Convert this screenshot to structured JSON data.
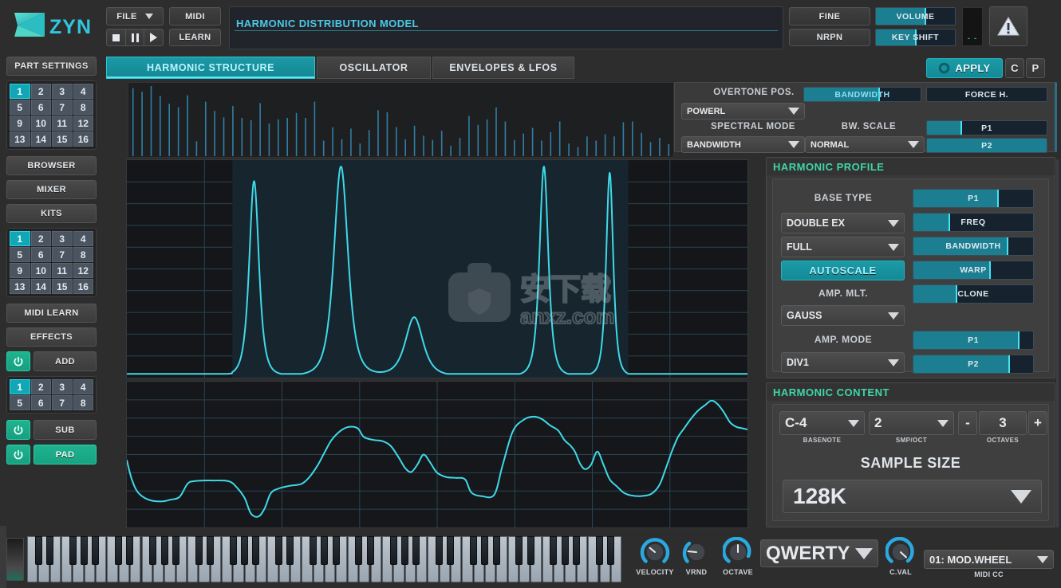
{
  "app": {
    "name": "ZYN",
    "accent_teal": "#13a6b5",
    "accent_green": "#3fd6a8",
    "curve_color": "#3fd9e8"
  },
  "header": {
    "file_menu": "FILE",
    "midi_button": "MIDI",
    "learn_button": "LEARN",
    "transport": {
      "stop": "stop-icon",
      "pause": "pause-icon",
      "play": "play-icon"
    },
    "title": "HARMONIC DISTRIBUTION MODEL",
    "fine_button": "FINE",
    "nrpn_button": "NRPN",
    "volume_slider": "VOLUME",
    "keyshift_slider": "KEY SHIFT",
    "meter_label": "- -",
    "warning_icon": "warning-triangle-icon"
  },
  "apply_row": {
    "apply": "APPLY",
    "copy": "C",
    "paste": "P"
  },
  "tabs": [
    {
      "label": "HARMONIC STRUCTURE",
      "active": true
    },
    {
      "label": "OSCILLATOR",
      "active": false
    },
    {
      "label": "ENVELOPES & LFOS",
      "active": false
    }
  ],
  "sidebar": {
    "part_settings": "PART SETTINGS",
    "part_numbers": [
      "1",
      "2",
      "3",
      "4",
      "5",
      "6",
      "7",
      "8",
      "9",
      "10",
      "11",
      "12",
      "13",
      "14",
      "15",
      "16"
    ],
    "part_selected": "1",
    "browser": "BROWSER",
    "mixer": "MIXER",
    "kits": "KITS",
    "kit_numbers": [
      "1",
      "2",
      "3",
      "4",
      "5",
      "6",
      "7",
      "8",
      "9",
      "10",
      "11",
      "12",
      "13",
      "14",
      "15",
      "16"
    ],
    "kit_selected": "1",
    "midi_learn": "MIDI LEARN",
    "effects": "EFFECTS",
    "add_label": "ADD",
    "add_voice_numbers": [
      "1",
      "2",
      "3",
      "4",
      "5",
      "6",
      "7",
      "8"
    ],
    "add_voice_selected": "1",
    "sub_label": "SUB",
    "pad_label": "PAD",
    "power_icon": "power-icon"
  },
  "top_settings": {
    "overtone_pos_label": "OVERTONE POS.",
    "overtone_pos_value": "POWERL",
    "bandwidth_slider": "BANDWIDTH",
    "bandwidth_slider_pct": 64,
    "force_h_slider": "FORCE H.",
    "force_h_pct": 0,
    "spectral_mode_label": "SPECTRAL MODE",
    "spectral_mode_value": "BANDWIDTH",
    "bw_scale_label": "BW. SCALE",
    "bw_scale_value": "NORMAL",
    "p1_slider": "P1",
    "p1_pct": 28,
    "p2_slider": "P2",
    "p2_pct": 100
  },
  "harmonic_profile": {
    "title": "HARMONIC PROFILE",
    "base_type_label": "BASE TYPE",
    "base_type_value": "DOUBLE EX",
    "shape_value": "FULL",
    "autoscale": "AUTOSCALE",
    "amp_mlt_label": "AMP. MLT.",
    "amp_mlt_value": "GAUSS",
    "amp_mode_label": "AMP. MODE",
    "amp_mode_value": "DIV1",
    "p1_slider": "P1",
    "p1_pct": 70,
    "freq_slider": "FREQ",
    "freq_pct": 29,
    "bandwidth_slider": "BANDWIDTH",
    "bandwidth_pct": 78,
    "warp_slider": "WARP",
    "warp_pct": 63,
    "clone_slider": "CLONE",
    "clone_pct": 35,
    "amp_p1_slider": "P1",
    "amp_p1_pct": 87,
    "amp_p2_slider": "P2",
    "amp_p2_pct": 79
  },
  "harmonic_content": {
    "title": "HARMONIC CONTENT",
    "basenote_value": "C-4",
    "basenote_label": "BASENOTE",
    "smp_oct_value": "2",
    "smp_oct_label": "SMP/OCT",
    "octaves_minus": "-",
    "octaves_value": "3",
    "octaves_plus": "+",
    "octaves_label": "OCTAVES",
    "sample_size_label": "SAMPLE SIZE",
    "sample_size_value": "128K"
  },
  "bottom_bar": {
    "velocity_label": "VELOCITY",
    "vrnd_label": "VRND",
    "octave_label": "OCTAVE",
    "keyboard_mode": "QWERTY",
    "cval_label": "C.VAL",
    "midi_cc_value": "01: MOD.WHEEL",
    "midi_cc_label": "MIDI CC"
  },
  "chart_data": [
    {
      "type": "bar",
      "name": "harmonic-amplitude-bars",
      "title": "",
      "xlabel": "",
      "ylabel": "",
      "ylim": [
        0,
        1
      ],
      "grid": false,
      "values": [
        0.97,
        0.92,
        1.0,
        0.86,
        0.75,
        0.7,
        0.87,
        0.22,
        0.78,
        0.65,
        0.56,
        0.72,
        0.55,
        0.52,
        0.76,
        0.47,
        0.53,
        0.55,
        0.62,
        0.55,
        0.78,
        0.23,
        0.42,
        0.25,
        0.4,
        0.19,
        0.38,
        0.66,
        0.63,
        0.42,
        0.25,
        0.44,
        0.3,
        0.24,
        0.37,
        0.16,
        0.27,
        0.58,
        0.45,
        0.53,
        0.7,
        0.5,
        0.24,
        0.33,
        0.41,
        0.23,
        0.35,
        0.5,
        0.19,
        0.14,
        0.29,
        0.23,
        0.32,
        0.29,
        0.49,
        0.5,
        0.34,
        0.21,
        0.27,
        0.18
      ]
    },
    {
      "type": "line",
      "name": "pad-spectrum-profile",
      "title": "",
      "xlabel": "",
      "ylabel": "",
      "grid": true,
      "xlim": [
        0,
        1
      ],
      "ylim": [
        0,
        1
      ],
      "series": [
        {
          "name": "spectrum",
          "color": "#3fd9e8",
          "peaks": [
            {
              "x": 0.205,
              "height": 0.93,
              "width": 0.011
            },
            {
              "x": 0.345,
              "height": 1.0,
              "width": 0.016
            },
            {
              "x": 0.463,
              "height": 0.28,
              "width": 0.02
            },
            {
              "x": 0.672,
              "height": 1.0,
              "width": 0.01
            },
            {
              "x": 0.778,
              "height": 0.97,
              "width": 0.008
            }
          ],
          "floor": 0.03
        }
      ]
    },
    {
      "type": "line",
      "name": "pad-waveform",
      "title": "",
      "xlabel": "",
      "ylabel": "",
      "grid": true,
      "xlim": [
        0,
        1
      ],
      "ylim": [
        0,
        1
      ],
      "series": [
        {
          "name": "waveform",
          "color": "#3fd9e8",
          "points": [
            [
              0.0,
              0.46
            ],
            [
              0.008,
              0.33
            ],
            [
              0.018,
              0.24
            ],
            [
              0.035,
              0.19
            ],
            [
              0.055,
              0.178
            ],
            [
              0.07,
              0.19
            ],
            [
              0.085,
              0.21
            ],
            [
              0.098,
              0.3
            ],
            [
              0.11,
              0.318
            ],
            [
              0.14,
              0.322
            ],
            [
              0.165,
              0.316
            ],
            [
              0.178,
              0.27
            ],
            [
              0.19,
              0.2
            ],
            [
              0.2,
              0.095
            ],
            [
              0.212,
              0.075
            ],
            [
              0.222,
              0.13
            ],
            [
              0.232,
              0.235
            ],
            [
              0.245,
              0.268
            ],
            [
              0.262,
              0.285
            ],
            [
              0.282,
              0.3
            ],
            [
              0.295,
              0.35
            ],
            [
              0.308,
              0.43
            ],
            [
              0.318,
              0.51
            ],
            [
              0.33,
              0.6
            ],
            [
              0.345,
              0.665
            ],
            [
              0.358,
              0.69
            ],
            [
              0.372,
              0.68
            ],
            [
              0.382,
              0.62
            ],
            [
              0.398,
              0.6
            ],
            [
              0.412,
              0.592
            ],
            [
              0.425,
              0.56
            ],
            [
              0.438,
              0.48
            ],
            [
              0.448,
              0.41
            ],
            [
              0.458,
              0.38
            ],
            [
              0.468,
              0.43
            ],
            [
              0.478,
              0.5
            ],
            [
              0.488,
              0.45
            ],
            [
              0.5,
              0.375
            ],
            [
              0.515,
              0.345
            ],
            [
              0.53,
              0.34
            ],
            [
              0.545,
              0.33
            ],
            [
              0.555,
              0.24
            ],
            [
              0.572,
              0.215
            ],
            [
              0.592,
              0.225
            ],
            [
              0.605,
              0.42
            ],
            [
              0.622,
              0.66
            ],
            [
              0.64,
              0.74
            ],
            [
              0.655,
              0.76
            ],
            [
              0.668,
              0.745
            ],
            [
              0.682,
              0.7
            ],
            [
              0.695,
              0.665
            ],
            [
              0.705,
              0.6
            ],
            [
              0.715,
              0.56
            ],
            [
              0.722,
              0.52
            ],
            [
              0.73,
              0.44
            ],
            [
              0.738,
              0.4
            ],
            [
              0.748,
              0.43
            ],
            [
              0.758,
              0.52
            ],
            [
              0.768,
              0.43
            ],
            [
              0.778,
              0.33
            ],
            [
              0.79,
              0.28
            ],
            [
              0.8,
              0.24
            ],
            [
              0.812,
              0.22
            ],
            [
              0.828,
              0.215
            ],
            [
              0.845,
              0.23
            ],
            [
              0.858,
              0.29
            ],
            [
              0.868,
              0.4
            ],
            [
              0.878,
              0.52
            ],
            [
              0.888,
              0.62
            ],
            [
              0.898,
              0.68
            ],
            [
              0.908,
              0.74
            ],
            [
              0.92,
              0.8
            ],
            [
              0.932,
              0.84
            ],
            [
              0.942,
              0.87
            ],
            [
              0.952,
              0.845
            ],
            [
              0.962,
              0.79
            ],
            [
              0.972,
              0.72
            ],
            [
              0.982,
              0.69
            ],
            [
              0.992,
              0.68
            ],
            [
              1.0,
              0.672
            ]
          ]
        }
      ]
    }
  ]
}
